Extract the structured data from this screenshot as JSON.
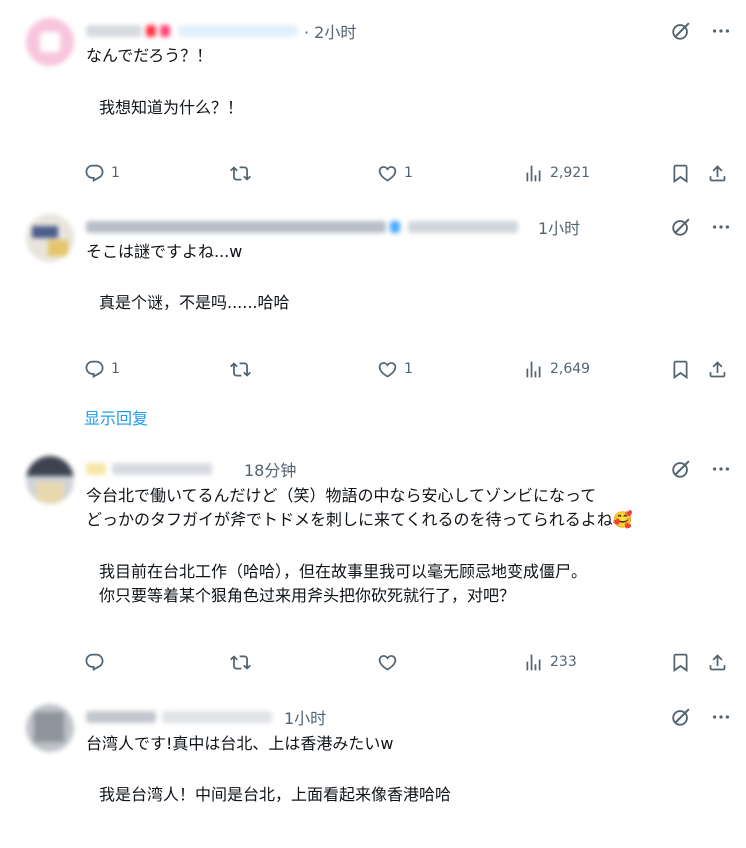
{
  "tweets": [
    {
      "time": "· 2小时",
      "text_original": "なんでだろう？！",
      "text_translation": [
        "我想知道为什么？！"
      ],
      "replies": "1",
      "retweets": "",
      "likes": "1",
      "views": "2,921"
    },
    {
      "time": "1小时",
      "text_original": "そこは謎ですよね...w",
      "text_translation": [
        "真是个谜，不是吗......哈哈"
      ],
      "replies": "1",
      "retweets": "",
      "likes": "1",
      "views": "2,649"
    },
    {
      "time": "18分钟",
      "text_original_lines": [
        "今台北で働いてるんだけど（笑）物語の中なら安心してゾンビになって",
        "どっかのタフガイが斧でトドメを刺しに来てくれるのを待ってられるよね"
      ],
      "text_translation": [
        "我目前在台北工作（哈哈），但在故事里我可以毫无顾忌地变成僵尸。",
        "你只要等着某个狠角色过来用斧头把你砍死就行了，对吧？"
      ],
      "replies": "",
      "retweets": "",
      "likes": "",
      "views": "233"
    },
    {
      "time": "1小时",
      "text_original": "台湾人です!真中は台北、上は香港みたいw",
      "text_translation": [
        "我是台湾人！中间是台北，上面看起来像香港哈哈"
      ]
    }
  ],
  "show_replies": "显示回复",
  "emoji": "🥰",
  "icons": {
    "reply": "reply-icon",
    "retweet": "retweet-icon",
    "like": "heart-icon",
    "views": "views-icon",
    "bookmark": "bookmark-icon",
    "share": "share-icon",
    "grok": "grok-icon",
    "more": "more-icon"
  },
  "colors": {
    "icon": "#536471",
    "link": "#1d9bf0",
    "text": "#0f1419"
  }
}
